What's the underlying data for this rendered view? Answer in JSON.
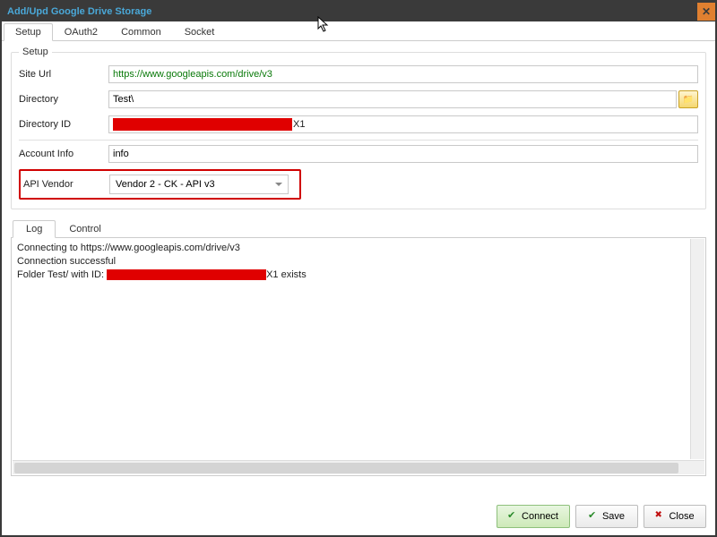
{
  "window": {
    "title": "Add/Upd Google Drive Storage",
    "tabs": [
      "Setup",
      "OAuth2",
      "Common",
      "Socket"
    ],
    "active_tab": "Setup"
  },
  "setup": {
    "legend": "Setup",
    "site_url_label": "Site Url",
    "site_url_value": "https://www.googleapis.com/drive/v3",
    "directory_label": "Directory",
    "directory_value": "Test\\",
    "directory_id_label": "Directory ID",
    "directory_id_suffix": "X1",
    "account_info_label": "Account Info",
    "account_info_value": "info",
    "api_vendor_label": "API Vendor",
    "api_vendor_value": "Vendor 2 - CK - API v3"
  },
  "subtabs": {
    "items": [
      "Log",
      "Control"
    ],
    "active": "Log"
  },
  "log": {
    "line1": "Connecting to https://www.googleapis.com/drive/v3",
    "line2": "Connection successful",
    "line3_prefix": "Folder Test/ with ID: ",
    "line3_suffix": "X1 exists"
  },
  "buttons": {
    "connect": "Connect",
    "save": "Save",
    "close": "Close"
  }
}
